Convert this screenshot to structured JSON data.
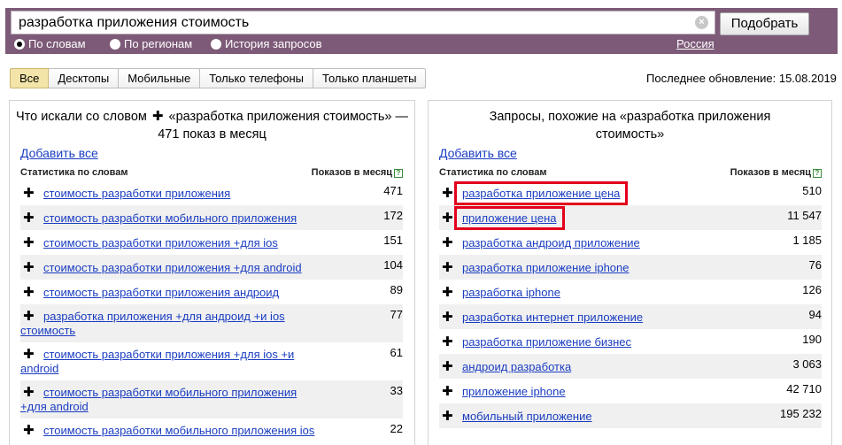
{
  "search": {
    "query": "разработка приложения стоимость",
    "submit_label": "Подобрать",
    "modes": [
      {
        "label": "По словам",
        "selected": true
      },
      {
        "label": "По регионам",
        "selected": false
      },
      {
        "label": "История запросов",
        "selected": false
      }
    ],
    "region": "Россия"
  },
  "tabs": [
    {
      "label": "Все",
      "active": true
    },
    {
      "label": "Десктопы",
      "active": false
    },
    {
      "label": "Мобильные",
      "active": false
    },
    {
      "label": "Только телефоны",
      "active": false
    },
    {
      "label": "Только планшеты",
      "active": false
    }
  ],
  "last_update": "Последнее обновление: 15.08.2019",
  "left_panel": {
    "title_before": "Что искали со словом",
    "title_after": "«разработка приложения стоимость» — 471 показ в месяц",
    "add_all": "Добавить все",
    "col_phrase": "Статистика по словам",
    "col_count": "Показов в месяц",
    "rows": [
      {
        "phrase": "стоимость разработки приложения",
        "count": "471"
      },
      {
        "phrase": "стоимость разработки мобильного приложения",
        "count": "172"
      },
      {
        "phrase": "стоимость разработки приложения +для ios",
        "count": "151"
      },
      {
        "phrase": "стоимость разработки приложения +для android",
        "count": "104"
      },
      {
        "phrase": "стоимость разработки приложения андроид",
        "count": "89"
      },
      {
        "phrase": "разработка приложения +для андроид +и ios стоимость",
        "count": "77"
      },
      {
        "phrase": "стоимость разработки приложения +для ios +и android",
        "count": "61"
      },
      {
        "phrase": "стоимость разработки мобильного приложения +для android",
        "count": "33"
      },
      {
        "phrase": "стоимость разработки мобильного приложения ios",
        "count": "22"
      }
    ]
  },
  "right_panel": {
    "title": "Запросы, похожие на «разработка приложения стоимость»",
    "add_all": "Добавить все",
    "col_phrase": "Статистика по словам",
    "col_count": "Показов в месяц",
    "rows": [
      {
        "phrase": "разработка приложение цена",
        "count": "510"
      },
      {
        "phrase": "приложение цена",
        "count": "11 547"
      },
      {
        "phrase": "разработка андроид приложение",
        "count": "1 185"
      },
      {
        "phrase": "разработка приложение iphone",
        "count": "76"
      },
      {
        "phrase": "разработка iphone",
        "count": "126"
      },
      {
        "phrase": "разработка интернет приложение",
        "count": "94"
      },
      {
        "phrase": "разработка приложение бизнес",
        "count": "190"
      },
      {
        "phrase": "андроид разработка",
        "count": "3 063"
      },
      {
        "phrase": "приложение iphone",
        "count": "42 710"
      },
      {
        "phrase": "мобильный приложение",
        "count": "195 232"
      }
    ]
  },
  "colors": {
    "header": "#7d5a78",
    "link": "#1a3dc1",
    "highlight": "#e3001b",
    "active_tab": "#f3e5a9"
  }
}
